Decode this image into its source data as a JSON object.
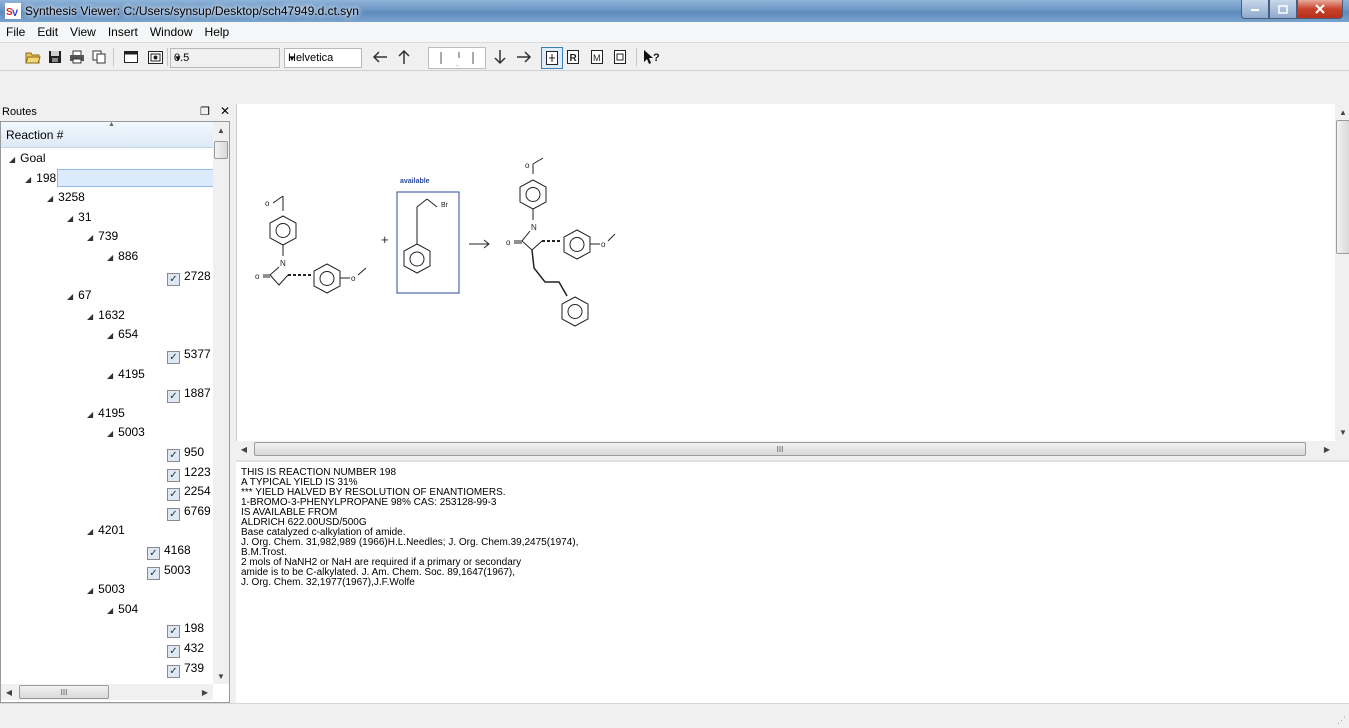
{
  "window": {
    "title": "Synthesis Viewer: C:/Users/synsup/Desktop/sch47949.d.ct.syn",
    "app_icon": "synthesis-viewer-logo-icon"
  },
  "menu": [
    "File",
    "Edit",
    "View",
    "Insert",
    "Window",
    "Help"
  ],
  "toolbar": {
    "zoom_value": "0.5",
    "font_value": "Helvetica",
    "icons": [
      "open-folder-icon",
      "save-icon",
      "print-icon",
      "copy-icon",
      "window-icon",
      "screenshot-icon",
      "arrow-left-icon",
      "arrow-up-icon",
      "arrow-down-icon",
      "arrow-right-icon",
      "view-mode-1-icon",
      "view-mode-2-icon",
      "view-mode-3-icon",
      "view-mode-4-icon",
      "context-help-icon"
    ]
  },
  "routes_panel": {
    "title": "Routes",
    "column_header": "Reaction #",
    "tree": [
      {
        "label": "Goal",
        "level": 0,
        "expanded": true
      },
      {
        "label": "198",
        "level": 1,
        "expanded": true,
        "selected": true
      },
      {
        "label": "3258",
        "level": 2,
        "expanded": true
      },
      {
        "label": "31",
        "level": 3,
        "expanded": true
      },
      {
        "label": "739",
        "level": 4,
        "expanded": true
      },
      {
        "label": "886",
        "level": 5,
        "expanded": true
      },
      {
        "label": "2728",
        "level": 6,
        "checked": true
      },
      {
        "label": "67",
        "level": 3,
        "expanded": true
      },
      {
        "label": "1632",
        "level": 4,
        "expanded": true
      },
      {
        "label": "654",
        "level": 5,
        "expanded": true
      },
      {
        "label": "5377",
        "level": 6,
        "checked": true
      },
      {
        "label": "4195",
        "level": 5,
        "expanded": true
      },
      {
        "label": "1887",
        "level": 6,
        "checked": true
      },
      {
        "label": "4195",
        "level": 4,
        "expanded": true
      },
      {
        "label": "5003",
        "level": 5,
        "expanded": true
      },
      {
        "label": "950",
        "level": 6,
        "checked": true
      },
      {
        "label": "1223",
        "level": 6,
        "checked": true
      },
      {
        "label": "2254",
        "level": 6,
        "checked": true
      },
      {
        "label": "6769",
        "level": 6,
        "checked": true
      },
      {
        "label": "4201",
        "level": 4,
        "expanded": true
      },
      {
        "label": "4168",
        "level": 5,
        "checked": true
      },
      {
        "label": "5003",
        "level": 5,
        "checked": true
      },
      {
        "label": "5003",
        "level": 4,
        "expanded": true
      },
      {
        "label": "504",
        "level": 5,
        "expanded": true
      },
      {
        "label": "198",
        "level": 6,
        "checked": true
      },
      {
        "label": "432",
        "level": 6,
        "checked": true
      },
      {
        "label": "739",
        "level": 6,
        "checked": true
      }
    ]
  },
  "reaction": {
    "available_label": "available",
    "reagent_label": "Br",
    "plus": "+",
    "atom_o": "o",
    "atom_n": "N"
  },
  "notes": [
    "THIS IS REACTION NUMBER 198",
    "A TYPICAL YIELD IS 31%",
    "*** YIELD HALVED BY RESOLUTION OF ENANTIOMERS.",
    "1-BROMO-3-PHENYLPROPANE 98% CAS: 253128-99-3",
    "IS AVAILABLE FROM",
    "ALDRICH 622.00USD/500G",
    "Base catalyzed c-alkylation of amide.",
    "J. Org. Chem. 31,982,989 (1966)H.L.Needles; J. Org. Chem.39,2475(1974),",
    "B.M.Trost.",
    "2 mols of NaNH2 or NaH are required if a primary or secondary",
    "amide is to be C-alkylated. J. Am. Chem. Soc. 89,1647(1967),",
    "J. Org. Chem. 32,1977(1967),J.F.Wolfe"
  ],
  "scrollbar_thumb": "III"
}
